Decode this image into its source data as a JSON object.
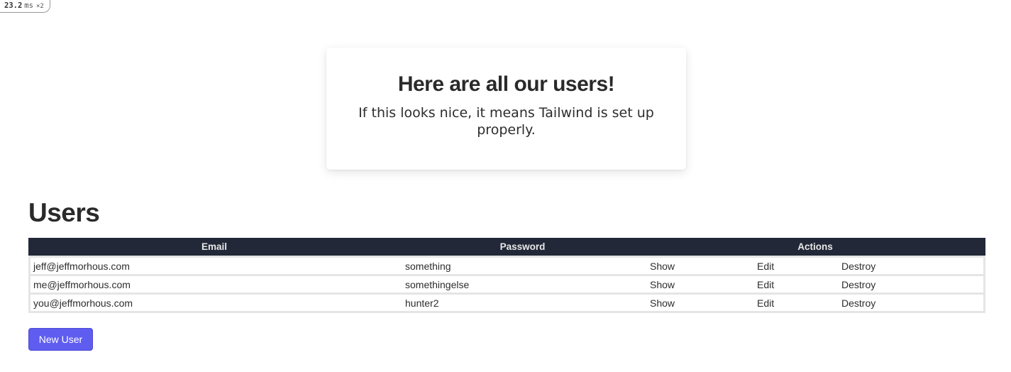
{
  "perf": {
    "value": "23.2",
    "unit": "ms",
    "multiplier": "×2"
  },
  "hero": {
    "title": "Here are all our users!",
    "text": "If this looks nice, it means Tailwind is set up properly."
  },
  "users_section": {
    "heading": "Users",
    "columns": {
      "email": "Email",
      "password": "Password",
      "actions": "Actions"
    },
    "rows": [
      {
        "email": "jeff@jeffmorhous.com",
        "password": "something",
        "show": "Show",
        "edit": "Edit",
        "destroy": "Destroy"
      },
      {
        "email": "me@jeffmorhous.com",
        "password": "somethingelse",
        "show": "Show",
        "edit": "Edit",
        "destroy": "Destroy"
      },
      {
        "email": "you@jeffmorhous.com",
        "password": "hunter2",
        "show": "Show",
        "edit": "Edit",
        "destroy": "Destroy"
      }
    ],
    "new_button": "New User"
  },
  "colors": {
    "header_bg": "#222838",
    "button_bg": "#5f5cf0",
    "text": "#2d2d2d"
  }
}
